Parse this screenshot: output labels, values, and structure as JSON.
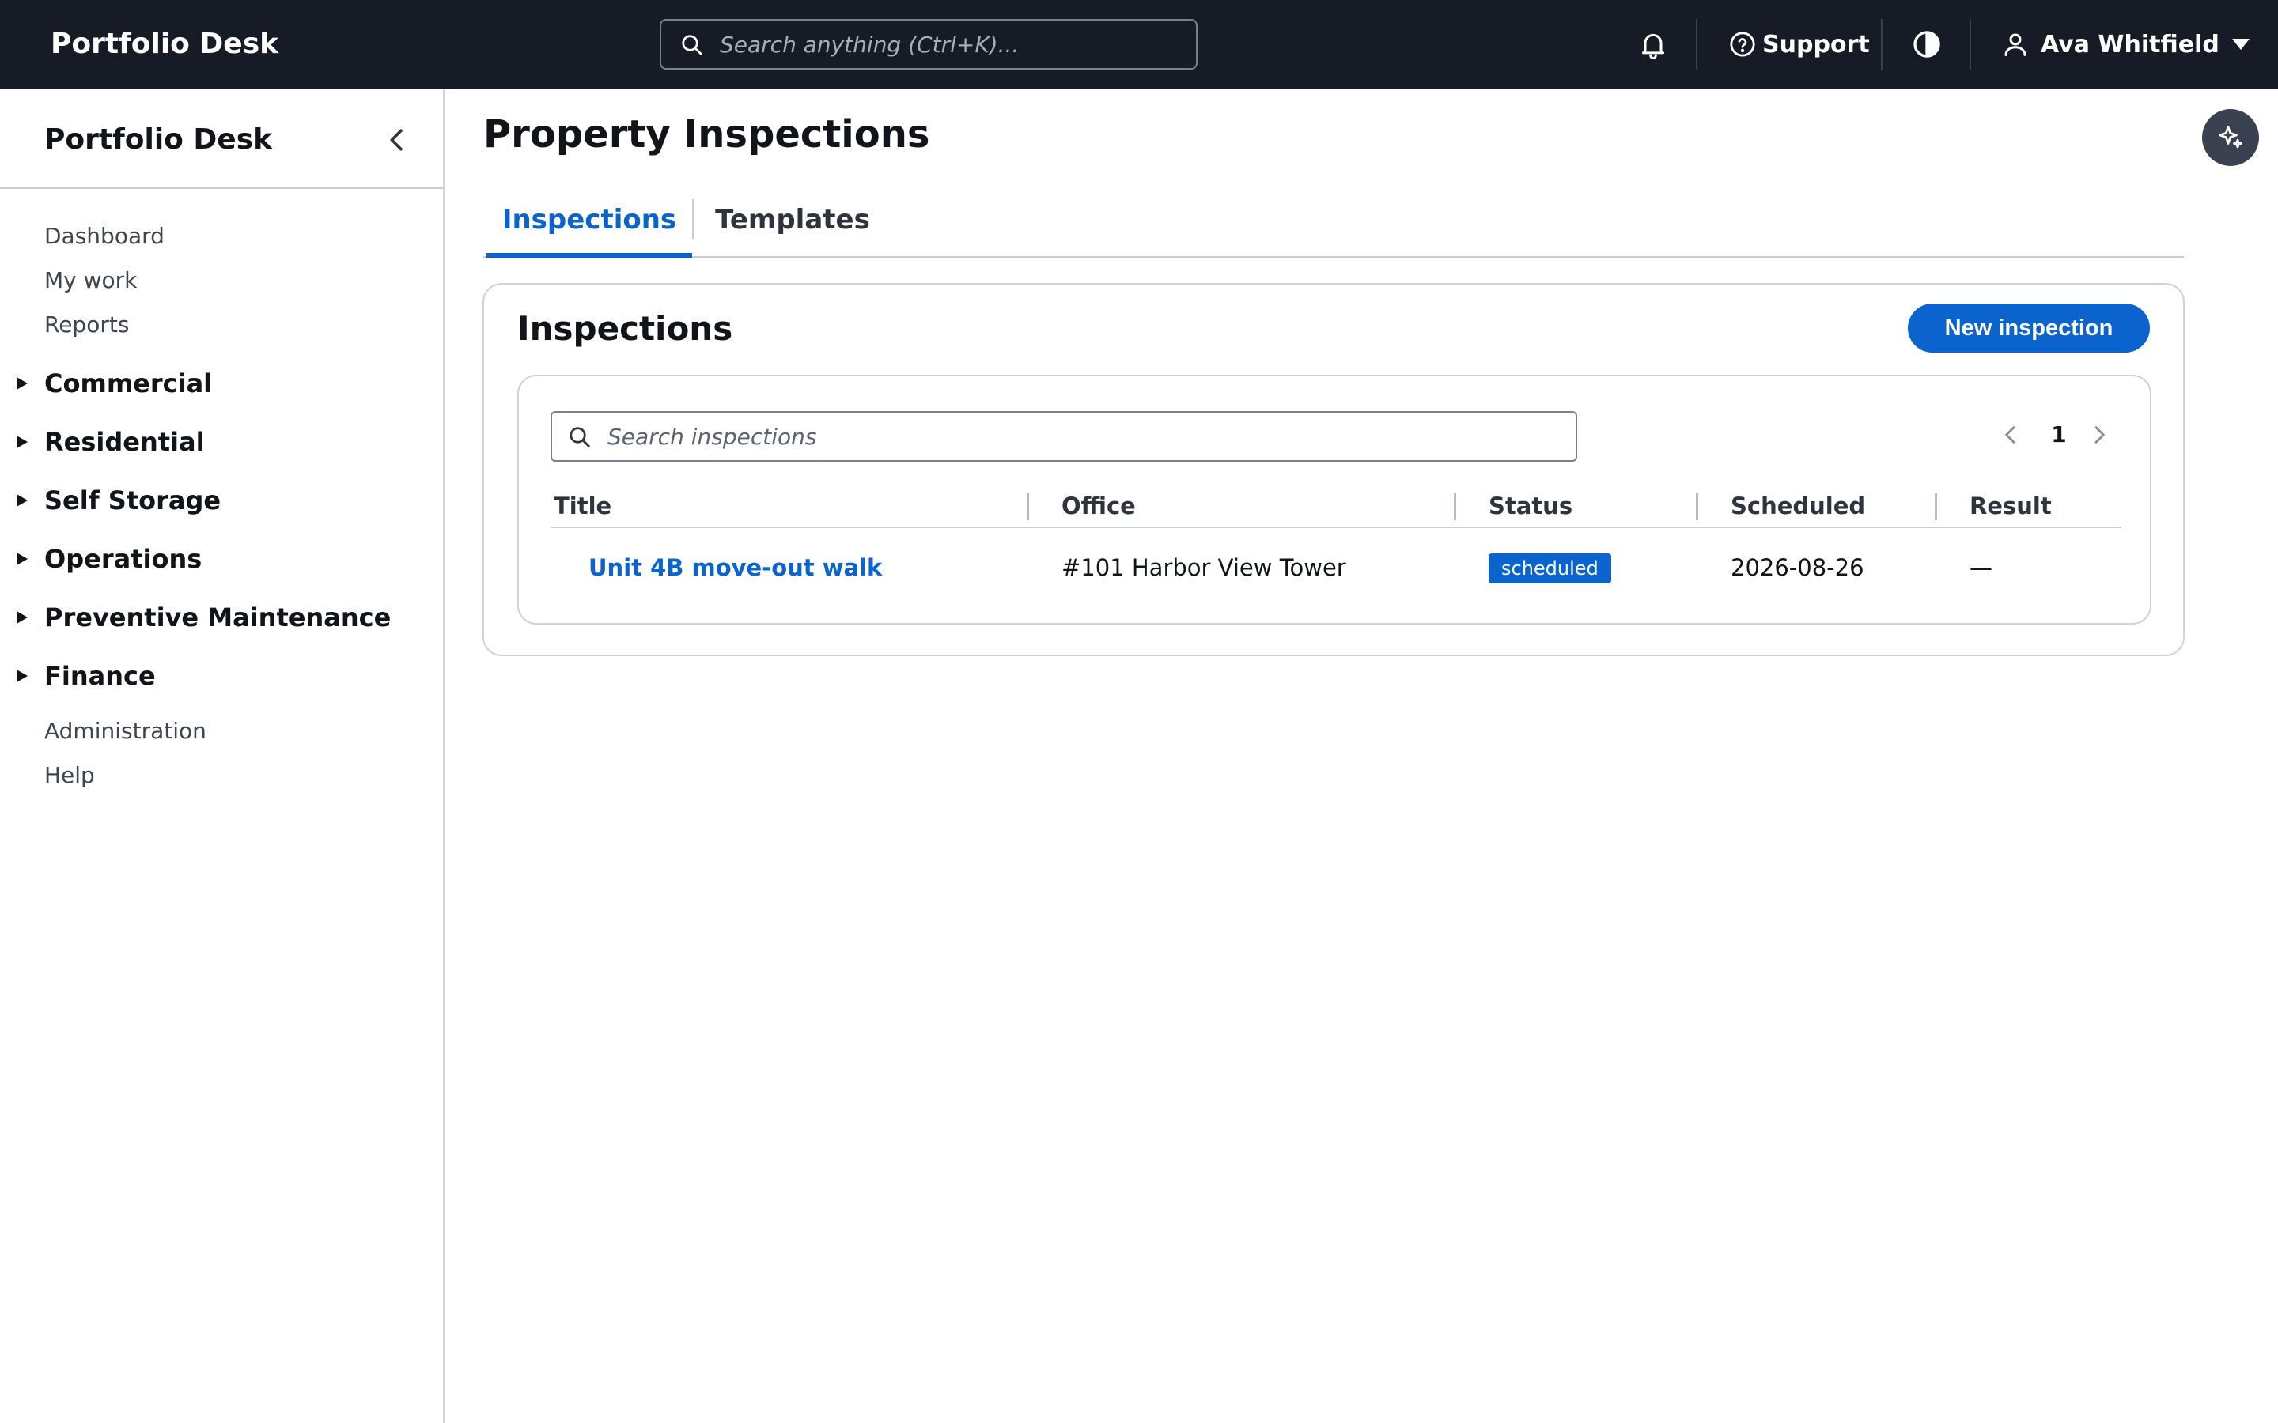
{
  "app": {
    "brand": "Portfolio Desk",
    "search_placeholder": "Search anything (Ctrl+K)...",
    "support_label": "Support",
    "user_name": "Ava Whitfield"
  },
  "sidebar": {
    "title": "Portfolio Desk",
    "top_items": [
      "Dashboard",
      "My work",
      "Reports"
    ],
    "groups": [
      "Commercial",
      "Residential",
      "Self Storage",
      "Operations",
      "Preventive Maintenance",
      "Finance"
    ],
    "bottom_items": [
      "Administration",
      "Help"
    ]
  },
  "main": {
    "page_title": "Property Inspections",
    "tabs": [
      {
        "label": "Inspections",
        "active": true
      },
      {
        "label": "Templates",
        "active": false
      }
    ],
    "card": {
      "title": "Inspections",
      "new_button_label": "New inspection",
      "search_placeholder": "Search inspections",
      "page_number": "1",
      "columns": [
        "Title",
        "Office",
        "Status",
        "Scheduled",
        "Result"
      ],
      "rows": [
        {
          "title": "Unit 4B move-out walk",
          "office": "#101 Harbor View Tower",
          "status": "scheduled",
          "scheduled": "2026-08-26",
          "result": "—"
        }
      ]
    }
  },
  "colors": {
    "topbar_bg": "#161b26",
    "accent": "#0b63ce",
    "status_badge": "#0b63ce"
  },
  "icons": [
    "search-icon",
    "bell-icon",
    "help-circle-icon",
    "contrast-icon",
    "user-icon",
    "caret-down-icon",
    "chevron-left-icon",
    "caret-right-icon",
    "sparkle-icon",
    "chevron-right-icon"
  ]
}
